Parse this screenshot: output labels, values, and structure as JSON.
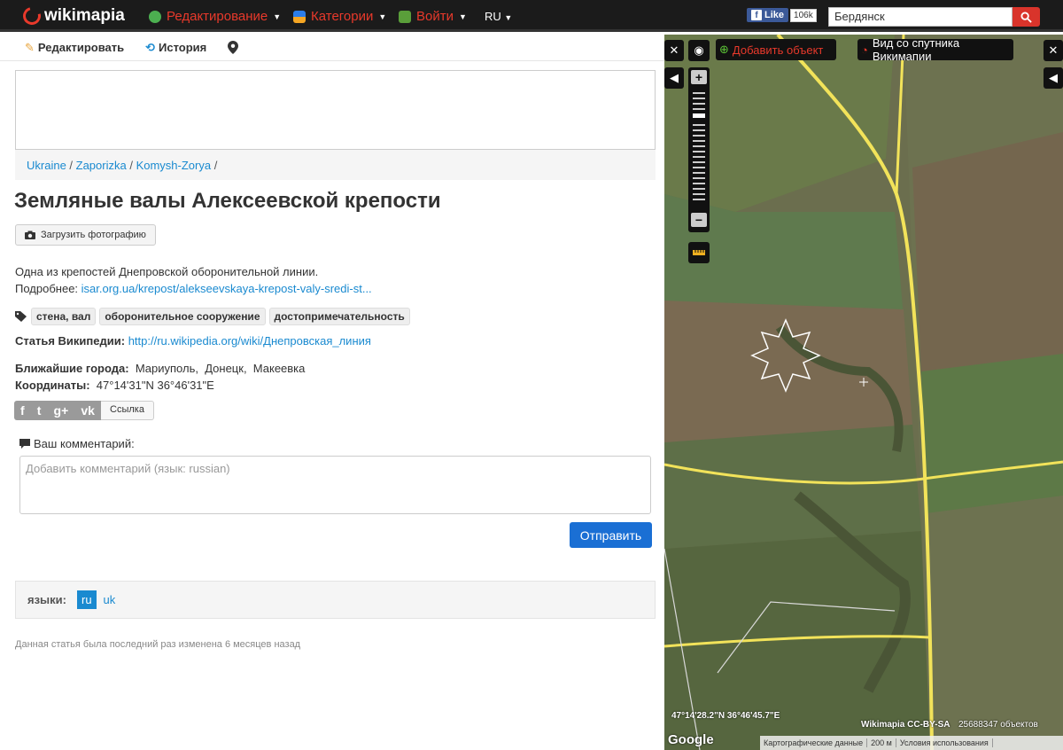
{
  "header": {
    "logo_text": "wikimapia",
    "nav": [
      {
        "label": "Редактирование",
        "icon": "globe-edit-icon"
      },
      {
        "label": "Категории",
        "icon": "categories-icon"
      },
      {
        "label": "Войти",
        "icon": "login-icon"
      }
    ],
    "lang": "RU",
    "fb_like": "Like",
    "fb_count": "106k",
    "search_value": "Бердянск"
  },
  "toolbar": {
    "edit": "Редактировать",
    "history": "История"
  },
  "breadcrumb": [
    {
      "label": "Ukraine"
    },
    {
      "label": "Zaporizka"
    },
    {
      "label": "Komysh-Zorya"
    }
  ],
  "place": {
    "title": "Земляные валы Алексеевской крепости",
    "upload_photo": "Загрузить фотографию",
    "description": "Одна из крепостей Днепровской оборонительной линии.",
    "more_label": "Подробнее:",
    "more_link": "isar.org.ua/krepost/alekseevskaya-krepost-valy-sredi-st...",
    "tags": [
      "стена, вал",
      "оборонительное сооружение",
      "достопримечательность"
    ],
    "wiki_label": "Статья Википедии:",
    "wiki_link": "http://ru.wikipedia.org/wiki/Днепровская_линия",
    "nearest_label": "Ближайшие города:",
    "nearest": [
      "Мариуполь",
      "Донецк",
      "Макеевка"
    ],
    "coords_label": "Координаты:",
    "coords": "47°14'31\"N 36°46'31\"E",
    "share_link": "Ссылка"
  },
  "comment": {
    "label": "Ваш комментарий:",
    "placeholder": "Добавить комментарий (язык: russian)",
    "send": "Отправить"
  },
  "languages": {
    "label": "языки:",
    "items": [
      "ru",
      "uk"
    ],
    "current": "ru"
  },
  "modified": "Данная статья была последний раз изменена 6 месяцев назад",
  "map": {
    "add_object": "Добавить объект",
    "sat_view": "Вид со спутника Викимапии",
    "cursor_coords": "47°14'28.2\"N 36°46'45.7\"E",
    "attribution": "Wikimapia CC-BY-SA",
    "object_count": "25688347 объектов",
    "google": "Google",
    "footer": [
      "Картографические данные",
      "200 м",
      "Условия использования"
    ]
  }
}
